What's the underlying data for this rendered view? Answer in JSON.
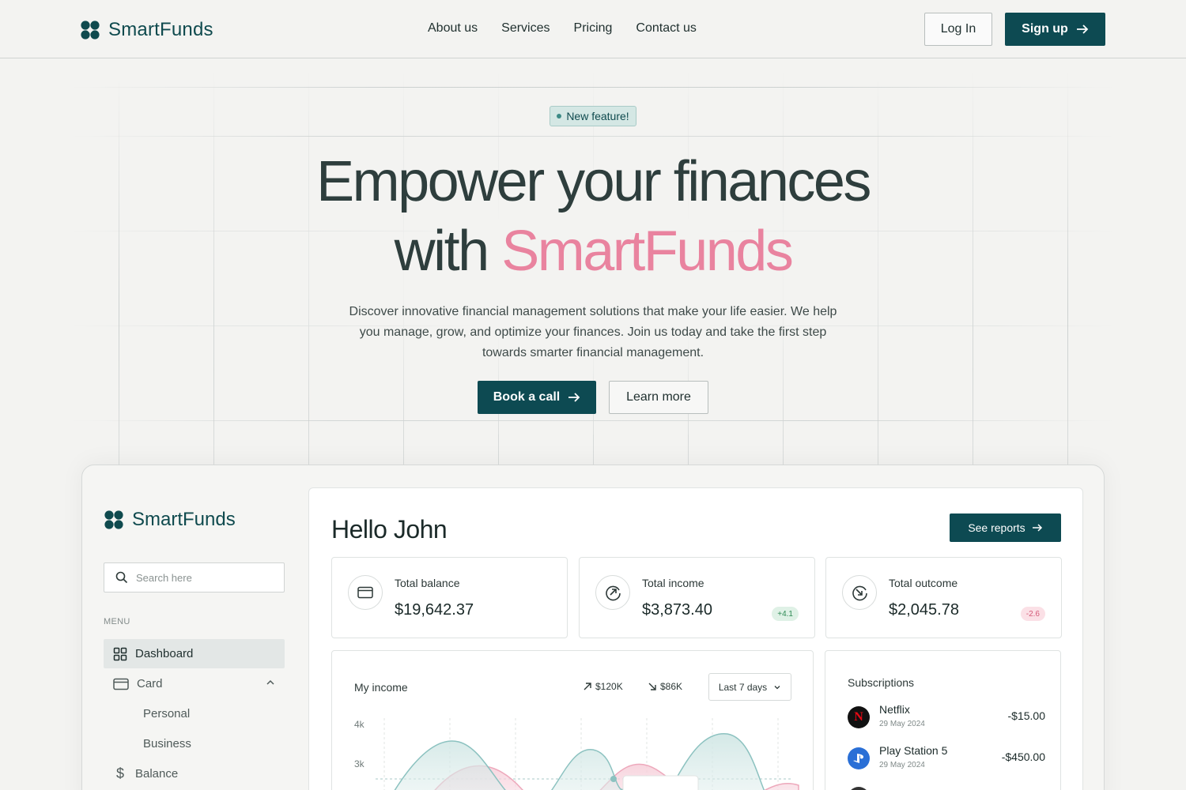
{
  "nav": {
    "brand": "SmartFunds",
    "links": [
      "About us",
      "Services",
      "Pricing",
      "Contact us"
    ],
    "login_label": "Log In",
    "signup_label": "Sign up"
  },
  "hero": {
    "badge": "New feature!",
    "title_line1": "Empower your finances",
    "title_with": "with ",
    "title_accent": "SmartFunds",
    "subtitle": "Discover innovative financial management solutions that make your life easier. We help you manage, grow, and optimize your finances. Join us today and take the first step towards smarter financial management.",
    "primary_cta": "Book a call",
    "secondary_cta": "Learn more"
  },
  "dashboard": {
    "brand": "SmartFunds",
    "search_placeholder": "Search here",
    "menu_label": "MENU",
    "menu": {
      "dashboard": "Dashboard",
      "card": "Card",
      "personal": "Personal",
      "business": "Business",
      "balance": "Balance"
    },
    "greeting": "Hello John",
    "see_reports": "See reports",
    "cards": [
      {
        "label": "Total balance",
        "value": "$19,642.37",
        "delta": ""
      },
      {
        "label": "Total income",
        "value": "$3,873.40",
        "delta": "+4.1"
      },
      {
        "label": "Total outcome",
        "value": "$2,045.78",
        "delta": "-2.6"
      }
    ],
    "income": {
      "title": "My income",
      "up_stat": "$120K",
      "down_stat": "$86K",
      "range": "Last 7 days",
      "y_ticks": [
        "4k",
        "3k"
      ]
    },
    "subscriptions": {
      "title": "Subscriptions",
      "items": [
        {
          "name": "Netflix",
          "date": "29 May 2024",
          "amount": "-$15.00"
        },
        {
          "name": "Play Station 5",
          "date": "29 May 2024",
          "amount": "-$450.00"
        }
      ]
    }
  },
  "colors": {
    "primary": "#0d4a52",
    "accent_pink": "#e9839f",
    "teal_series": "#8cc2c0",
    "pink_series": "#f0b3c3"
  }
}
